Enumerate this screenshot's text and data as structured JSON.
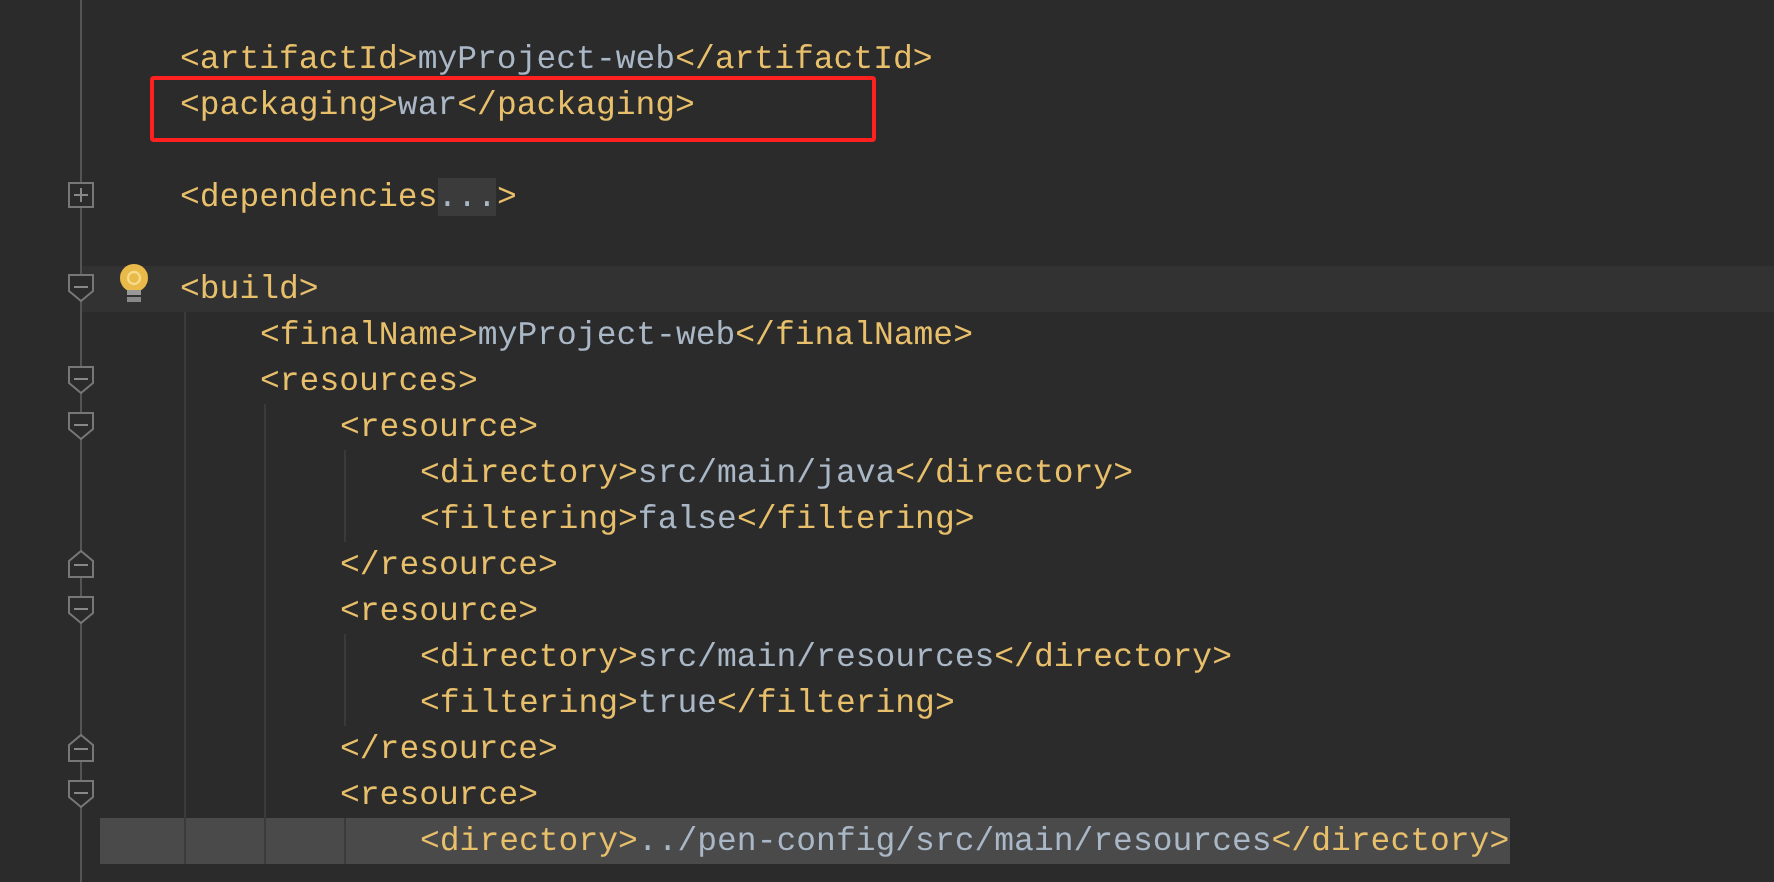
{
  "editor": {
    "nodes": [
      {
        "kind": "leaf",
        "open": "<artifactId>",
        "value": "myProject-web",
        "close": "</artifactId>"
      },
      {
        "kind": "leaf",
        "open": "<packaging>",
        "value": "war",
        "close": "</packaging>",
        "boxed": true
      },
      {
        "kind": "blank"
      },
      {
        "kind": "fold",
        "expanded": false,
        "open": "<dependencies",
        "placeholder": "...",
        "close": ">"
      },
      {
        "kind": "blank"
      },
      {
        "kind": "fold",
        "expanded": true,
        "current": true,
        "bulb": true,
        "open": "<build>",
        "children": [
          {
            "kind": "leaf",
            "open": "<finalName>",
            "value": "myProject-web",
            "close": "</finalName>"
          },
          {
            "kind": "fold",
            "expanded": true,
            "open": "<resources>",
            "children": [
              {
                "kind": "fold",
                "expanded": true,
                "open": "<resource>",
                "close": "</resource>",
                "children": [
                  {
                    "kind": "leaf",
                    "open": "<directory>",
                    "value": "src/main/java",
                    "close": "</directory>"
                  },
                  {
                    "kind": "leaf",
                    "open": "<filtering>",
                    "value": "false",
                    "close": "</filtering>"
                  }
                ]
              },
              {
                "kind": "fold",
                "expanded": true,
                "open": "<resource>",
                "close": "</resource>",
                "children": [
                  {
                    "kind": "leaf",
                    "open": "<directory>",
                    "value": "src/main/resources",
                    "close": "</directory>"
                  },
                  {
                    "kind": "leaf",
                    "open": "<filtering>",
                    "value": "true",
                    "close": "</filtering>"
                  }
                ]
              },
              {
                "kind": "fold",
                "expanded": true,
                "open": "<resource>",
                "children": [
                  {
                    "kind": "leaf",
                    "text_selected": true,
                    "open": "<directory>",
                    "value": "../pen-config/src/main/resources",
                    "close": "</directory>"
                  }
                ]
              }
            ]
          }
        ]
      }
    ]
  }
}
